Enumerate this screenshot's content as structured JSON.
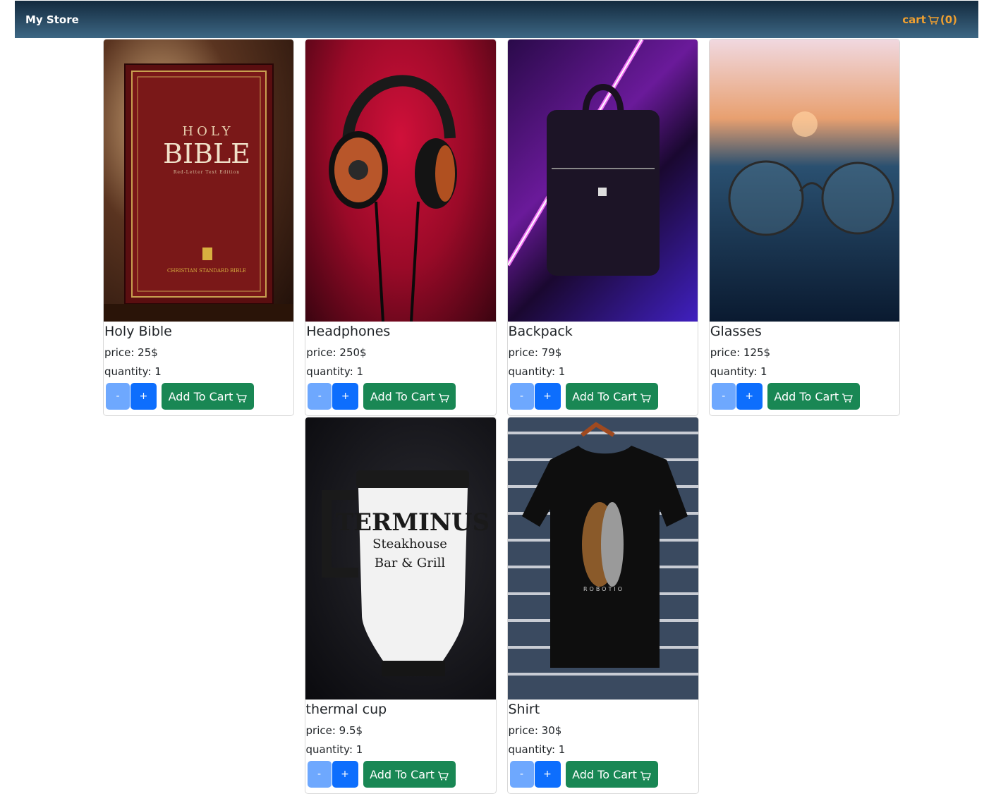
{
  "navbar": {
    "brand": "My Store",
    "cart_label": "cart",
    "cart_count": "(0)"
  },
  "buttons": {
    "minus": "-",
    "plus": "+",
    "add_to_cart": "Add To Cart"
  },
  "products": [
    {
      "name": "Holy Bible",
      "price": "price: 25$",
      "quantity": "quantity: 1",
      "book_line1": "HOLY",
      "book_line2": "BIBLE",
      "book_sub": "Red-Letter Text Edition",
      "publisher": "CHRISTIAN STANDARD BIBLE"
    },
    {
      "name": "Headphones",
      "price": "price: 250$",
      "quantity": "quantity: 1"
    },
    {
      "name": "Backpack",
      "price": "price: 79$",
      "quantity": "quantity: 1"
    },
    {
      "name": "Glasses",
      "price": "price: 125$",
      "quantity": "quantity: 1"
    },
    {
      "name": "thermal cup",
      "price": "price: 9.5$",
      "quantity": "quantity: 1",
      "cup_line1": "TERMINUS",
      "cup_line2": "Steakhouse",
      "cup_line3": "Bar & Grill"
    },
    {
      "name": "Shirt",
      "price": "price: 30$",
      "quantity": "quantity: 1",
      "shirt_print": "ROBOTIO"
    }
  ]
}
